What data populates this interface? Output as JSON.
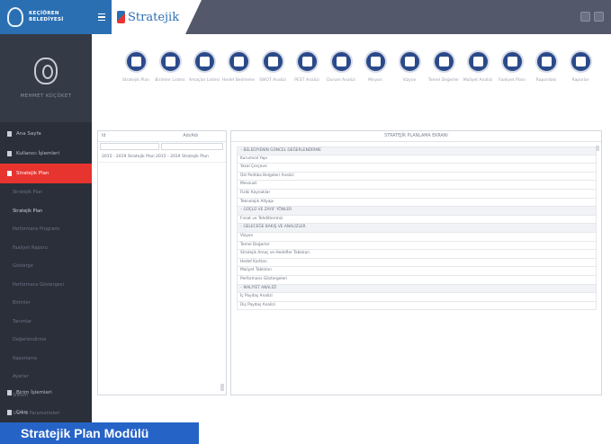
{
  "app": {
    "brand_name": "Stratejik",
    "logo_text_line1": "KEÇİÖREN",
    "logo_text_line2": "BELEDİYESİ"
  },
  "profile": {
    "name": "MEHMET KÜÇÜKET"
  },
  "sidebar": {
    "items": [
      {
        "label": "Ana Sayfa",
        "active": false
      },
      {
        "label": "Kullanıcı İşlemleri",
        "active": false
      },
      {
        "label": "Stratejik Plan",
        "active": true
      }
    ],
    "sub_items": [
      {
        "label": "Stratejik Plan",
        "current": false
      },
      {
        "label": "Stratejik Plan",
        "current": true
      },
      {
        "label": "Performans Programı",
        "current": false
      },
      {
        "label": "Faaliyet Raporu",
        "current": false
      },
      {
        "label": "Gösterge",
        "current": false
      },
      {
        "label": "Performans Göstergesi",
        "current": false
      },
      {
        "label": "Birimler",
        "current": false
      },
      {
        "label": "Tanımlar",
        "current": false
      },
      {
        "label": "Değerlendirme",
        "current": false
      },
      {
        "label": "Raporlama",
        "current": false
      },
      {
        "label": "Ayarlar",
        "current": false
      },
      {
        "label": "Sistem",
        "current": false
      },
      {
        "label": "Sistem Parametreleri",
        "current": false
      }
    ],
    "bottom_items": [
      {
        "label": "Birim İşlemleri"
      },
      {
        "label": "Çıkış"
      }
    ]
  },
  "toolbar": {
    "tools": [
      {
        "label": "Stratejik Plan",
        "icon": "people-icon"
      },
      {
        "label": "Birimler Listesi",
        "icon": "folder-icon"
      },
      {
        "label": "Amaçlar Listesi",
        "icon": "clipboard-icon"
      },
      {
        "label": "Hedef Belirleme",
        "icon": "network-icon"
      },
      {
        "label": "SWOT Analizi",
        "icon": "grid-icon"
      },
      {
        "label": "PEST Analizi",
        "icon": "grid-color-icon"
      },
      {
        "label": "Durum Analizi",
        "icon": "pie-icon"
      },
      {
        "label": "Misyon",
        "icon": "blue-circle-icon"
      },
      {
        "label": "Vizyon",
        "icon": "eye-icon"
      },
      {
        "label": "Temel Değerler",
        "icon": "shield-icon"
      },
      {
        "label": "Maliyet Analizi",
        "icon": "bulb-icon"
      },
      {
        "label": "Faaliyet Planı",
        "icon": "document-icon"
      },
      {
        "label": "Rapordaki",
        "icon": "chart-icon"
      },
      {
        "label": "Raporlar",
        "icon": "report-search-icon"
      }
    ]
  },
  "left_panel": {
    "columns": [
      "Id",
      "Adı/Adı"
    ],
    "rows": [
      {
        "id": "2015 - 2019 Stratejik Plan",
        "name": "2015 - 2019 Stratejik Plan"
      }
    ]
  },
  "right_panel": {
    "title": "STRATEJİK PLANLAMA EKRANI",
    "rows": [
      {
        "text": "BELEDİYENİN GÜNCEL DEĞERLENDİRME",
        "group": true
      },
      {
        "text": "Kurumsal Yapı",
        "group": false
      },
      {
        "text": "Yasal Çerçeve",
        "group": false
      },
      {
        "text": "Üst Politika Belgeleri Analizi",
        "group": false
      },
      {
        "text": "Mevzuat",
        "group": false
      },
      {
        "text": "Fiziki Kaynaklar",
        "group": false
      },
      {
        "text": "Teknolojik Altyapı",
        "group": false
      },
      {
        "text": "GÜÇLÜ VE ZAYIF YÖNLER",
        "group": true
      },
      {
        "text": "Fırsat ve Tehditlerimiz",
        "group": false
      },
      {
        "text": "GELECEĞE BAKIŞ VE ANALİZLER",
        "group": true
      },
      {
        "text": "Vizyon",
        "group": false
      },
      {
        "text": "Temel Değerler",
        "group": false
      },
      {
        "text": "Stratejik Amaç ve Hedefler Tabloları",
        "group": false
      },
      {
        "text": "Hedef Kartları",
        "group": false
      },
      {
        "text": "Maliyet Tabloları",
        "group": false
      },
      {
        "text": "Performans Göstergeleri",
        "group": false
      },
      {
        "text": "MALİYET ANALİZİ",
        "group": true
      },
      {
        "text": "İç Paydaş Analizi",
        "group": false
      },
      {
        "text": "Dış Paydaş Analizi",
        "group": false
      }
    ]
  },
  "caption": "Stratejik Plan Modülü",
  "colors": {
    "accent_blue": "#2b6fb3",
    "active_red": "#e8342f",
    "sidebar_bg": "#2a2f3a",
    "topbar_bg": "#53596a",
    "caption_bg": "#2563c7"
  }
}
